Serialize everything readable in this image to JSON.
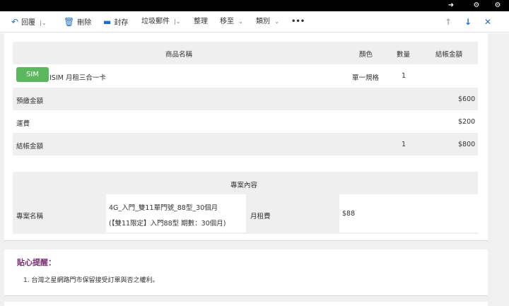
{
  "toolbar": {
    "reply": "回覆",
    "delete": "刪除",
    "archive": "封存",
    "junk": "垃圾郵件",
    "sweep": "整理",
    "move_to": "移至",
    "categories": "類別",
    "more": "•••",
    "up_icon": "arrow-up-icon",
    "down_icon": "arrow-down-icon",
    "close": "✕"
  },
  "order_table": {
    "headers": {
      "product_name": "商品名稱",
      "color": "顏色",
      "quantity": "數量",
      "checkout_amount": "結帳金額"
    },
    "product": {
      "badge": "SIM",
      "name": "ISIM 月租三合一卡",
      "spec": "單一規格",
      "quantity": "1"
    },
    "rows": [
      {
        "label": "預繳金額",
        "amount": "$600"
      },
      {
        "label": "運費",
        "amount": "$200"
      }
    ],
    "total": {
      "label": "結帳金額",
      "quantity": "1",
      "amount": "$800"
    }
  },
  "plan_table": {
    "header": "專案內容",
    "plan_name_label": "專案名稱",
    "plan_name_line1": "4G_入門_雙11單門號_88型_30個月",
    "plan_name_line2": "(【雙11限定】入門88型 期數：30個月)",
    "monthly_fee_label": "月租費",
    "monthly_fee": "$88"
  },
  "reminder": {
    "title": "貼心提醒：",
    "item1": "1. 台灣之星網路門市保留接受訂單與否之權利。"
  },
  "colors": {
    "accent": "#1e6ec8",
    "badge_green": "#5cb85c",
    "reminder_title": "#7b2d72"
  }
}
